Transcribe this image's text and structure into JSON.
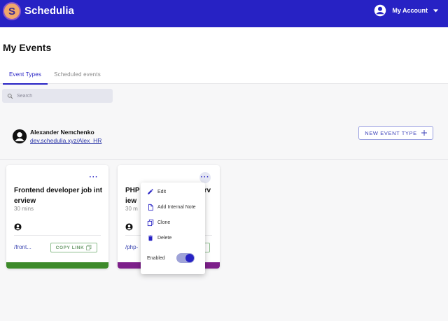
{
  "app": {
    "logo_letter": "S",
    "brand": "Schedulia"
  },
  "account": {
    "label": "My Account"
  },
  "page": {
    "title": "My Events"
  },
  "tabs": [
    {
      "label": "Event Types",
      "active": true
    },
    {
      "label": "Scheduled events",
      "active": false
    }
  ],
  "search": {
    "placeholder": "Search"
  },
  "user": {
    "name": "Alexander Nemchenko",
    "link": "dev.schedulia.xyz/Alex_HR"
  },
  "new_event": {
    "label": "NEW EVENT TYPE",
    "icon": "plus-icon"
  },
  "cards": [
    {
      "title": "Frontend developer job interview",
      "duration": "30 mins",
      "link": "/front...",
      "copy_label": "COPY LINK",
      "bar_color": "#3d8a2a"
    },
    {
      "title": "PHP developer job interview",
      "title_visible": "PHP",
      "title_tail": "rv",
      "title_line2": "iew",
      "duration": "30 m",
      "link": "/php-",
      "bar_color": "#7d1f8a"
    }
  ],
  "menu": {
    "items": [
      {
        "label": "Edit",
        "icon": "pencil-icon"
      },
      {
        "label": "Add Internal Note",
        "icon": "note-icon"
      },
      {
        "label": "Clone",
        "icon": "copy-icon"
      },
      {
        "label": "Delete",
        "icon": "trash-icon"
      }
    ],
    "toggle_label": "Enabled",
    "enabled": true
  },
  "colors": {
    "primary": "#2722c4",
    "background": "#f7f7f8"
  }
}
